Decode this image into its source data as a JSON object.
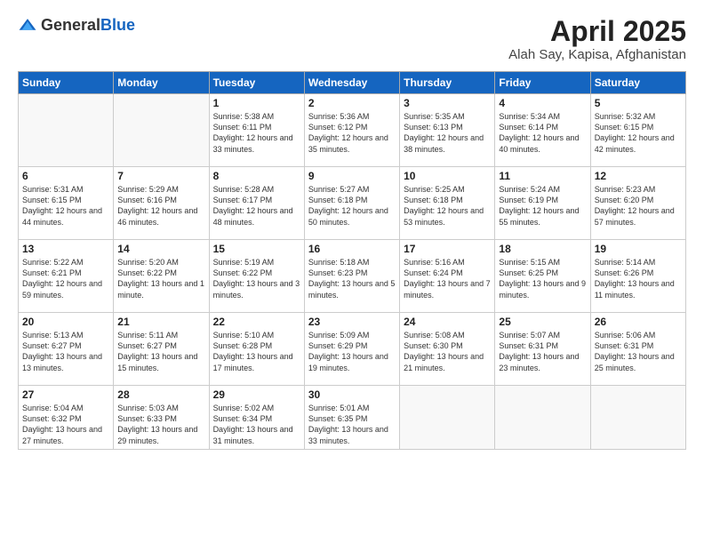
{
  "logo": {
    "general": "General",
    "blue": "Blue"
  },
  "header": {
    "month_year": "April 2025",
    "location": "Alah Say, Kapisa, Afghanistan"
  },
  "weekdays": [
    "Sunday",
    "Monday",
    "Tuesday",
    "Wednesday",
    "Thursday",
    "Friday",
    "Saturday"
  ],
  "weeks": [
    [
      {
        "day": "",
        "info": ""
      },
      {
        "day": "",
        "info": ""
      },
      {
        "day": "1",
        "info": "Sunrise: 5:38 AM\nSunset: 6:11 PM\nDaylight: 12 hours and 33 minutes."
      },
      {
        "day": "2",
        "info": "Sunrise: 5:36 AM\nSunset: 6:12 PM\nDaylight: 12 hours and 35 minutes."
      },
      {
        "day": "3",
        "info": "Sunrise: 5:35 AM\nSunset: 6:13 PM\nDaylight: 12 hours and 38 minutes."
      },
      {
        "day": "4",
        "info": "Sunrise: 5:34 AM\nSunset: 6:14 PM\nDaylight: 12 hours and 40 minutes."
      },
      {
        "day": "5",
        "info": "Sunrise: 5:32 AM\nSunset: 6:15 PM\nDaylight: 12 hours and 42 minutes."
      }
    ],
    [
      {
        "day": "6",
        "info": "Sunrise: 5:31 AM\nSunset: 6:15 PM\nDaylight: 12 hours and 44 minutes."
      },
      {
        "day": "7",
        "info": "Sunrise: 5:29 AM\nSunset: 6:16 PM\nDaylight: 12 hours and 46 minutes."
      },
      {
        "day": "8",
        "info": "Sunrise: 5:28 AM\nSunset: 6:17 PM\nDaylight: 12 hours and 48 minutes."
      },
      {
        "day": "9",
        "info": "Sunrise: 5:27 AM\nSunset: 6:18 PM\nDaylight: 12 hours and 50 minutes."
      },
      {
        "day": "10",
        "info": "Sunrise: 5:25 AM\nSunset: 6:18 PM\nDaylight: 12 hours and 53 minutes."
      },
      {
        "day": "11",
        "info": "Sunrise: 5:24 AM\nSunset: 6:19 PM\nDaylight: 12 hours and 55 minutes."
      },
      {
        "day": "12",
        "info": "Sunrise: 5:23 AM\nSunset: 6:20 PM\nDaylight: 12 hours and 57 minutes."
      }
    ],
    [
      {
        "day": "13",
        "info": "Sunrise: 5:22 AM\nSunset: 6:21 PM\nDaylight: 12 hours and 59 minutes."
      },
      {
        "day": "14",
        "info": "Sunrise: 5:20 AM\nSunset: 6:22 PM\nDaylight: 13 hours and 1 minute."
      },
      {
        "day": "15",
        "info": "Sunrise: 5:19 AM\nSunset: 6:22 PM\nDaylight: 13 hours and 3 minutes."
      },
      {
        "day": "16",
        "info": "Sunrise: 5:18 AM\nSunset: 6:23 PM\nDaylight: 13 hours and 5 minutes."
      },
      {
        "day": "17",
        "info": "Sunrise: 5:16 AM\nSunset: 6:24 PM\nDaylight: 13 hours and 7 minutes."
      },
      {
        "day": "18",
        "info": "Sunrise: 5:15 AM\nSunset: 6:25 PM\nDaylight: 13 hours and 9 minutes."
      },
      {
        "day": "19",
        "info": "Sunrise: 5:14 AM\nSunset: 6:26 PM\nDaylight: 13 hours and 11 minutes."
      }
    ],
    [
      {
        "day": "20",
        "info": "Sunrise: 5:13 AM\nSunset: 6:27 PM\nDaylight: 13 hours and 13 minutes."
      },
      {
        "day": "21",
        "info": "Sunrise: 5:11 AM\nSunset: 6:27 PM\nDaylight: 13 hours and 15 minutes."
      },
      {
        "day": "22",
        "info": "Sunrise: 5:10 AM\nSunset: 6:28 PM\nDaylight: 13 hours and 17 minutes."
      },
      {
        "day": "23",
        "info": "Sunrise: 5:09 AM\nSunset: 6:29 PM\nDaylight: 13 hours and 19 minutes."
      },
      {
        "day": "24",
        "info": "Sunrise: 5:08 AM\nSunset: 6:30 PM\nDaylight: 13 hours and 21 minutes."
      },
      {
        "day": "25",
        "info": "Sunrise: 5:07 AM\nSunset: 6:31 PM\nDaylight: 13 hours and 23 minutes."
      },
      {
        "day": "26",
        "info": "Sunrise: 5:06 AM\nSunset: 6:31 PM\nDaylight: 13 hours and 25 minutes."
      }
    ],
    [
      {
        "day": "27",
        "info": "Sunrise: 5:04 AM\nSunset: 6:32 PM\nDaylight: 13 hours and 27 minutes."
      },
      {
        "day": "28",
        "info": "Sunrise: 5:03 AM\nSunset: 6:33 PM\nDaylight: 13 hours and 29 minutes."
      },
      {
        "day": "29",
        "info": "Sunrise: 5:02 AM\nSunset: 6:34 PM\nDaylight: 13 hours and 31 minutes."
      },
      {
        "day": "30",
        "info": "Sunrise: 5:01 AM\nSunset: 6:35 PM\nDaylight: 13 hours and 33 minutes."
      },
      {
        "day": "",
        "info": ""
      },
      {
        "day": "",
        "info": ""
      },
      {
        "day": "",
        "info": ""
      }
    ]
  ]
}
